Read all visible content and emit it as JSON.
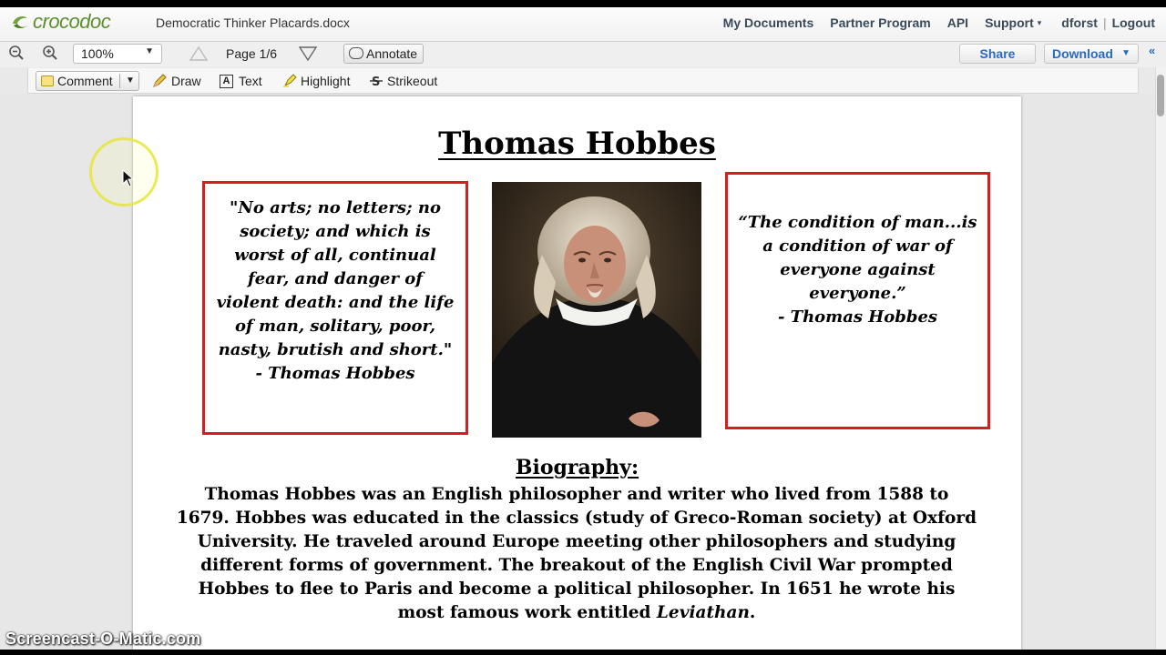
{
  "app": {
    "brand": "crocodoc",
    "document_title": "Democratic Thinker Placards.docx"
  },
  "topnav": {
    "my_documents": "My Documents",
    "partner_program": "Partner Program",
    "api": "API",
    "support": "Support",
    "user": "dforst",
    "separator": "|",
    "logout": "Logout"
  },
  "toolbar": {
    "zoom_value": "100%",
    "page_label": "Page 1/6",
    "annotate_label": "Annotate",
    "share_label": "Share",
    "download_label": "Download",
    "collapse_label": "«"
  },
  "annotation_tools": {
    "comment": "Comment",
    "draw": "Draw",
    "text": "Text",
    "highlight": "Highlight",
    "strikeout": "Strikeout"
  },
  "document": {
    "heading": "Thomas Hobbes",
    "quote_left": "\"No arts; no letters; no\nsociety; and which is\nworst of all, continual\nfear, and danger of\nviolent death: and the life\nof man, solitary, poor,\nnasty, brutish and short.\"\n- Thomas Hobbes",
    "quote_right": "“The condition of man...is\na condition of war of\neveryone against\neveryone.”\n- Thomas Hobbes",
    "bio_heading": "Biography:",
    "bio_lines": [
      "Thomas Hobbes was an English philosopher and writer who lived from 1588 to",
      "1679. Hobbes was educated in the classics (study of Greco-Roman society) at Oxford",
      "University. He traveled around Europe meeting other philosophers and studying",
      "different forms of government. The breakout of the English Civil War prompted",
      "Hobbes to flee to Paris and become a political philosopher. In 1651 he wrote his"
    ],
    "bio_last_prefix": "most famous work entitled ",
    "bio_last_italic": "Leviathan",
    "bio_last_suffix": "."
  },
  "watermark": "Screencast-O-Matic.com",
  "colors": {
    "brand_green": "#5d8f2e",
    "link_blue": "#2a6bbd",
    "quote_border": "#d21f1f",
    "cursor_ring": "#e6e63c"
  },
  "icons": [
    "crocodoc-logo-icon",
    "zoom-out-icon",
    "zoom-in-icon",
    "page-up-icon",
    "page-down-icon",
    "speech-bubble-icon",
    "comment-icon",
    "pencil-icon",
    "text-box-icon",
    "highlighter-icon",
    "strikeout-icon",
    "cursor-icon"
  ]
}
